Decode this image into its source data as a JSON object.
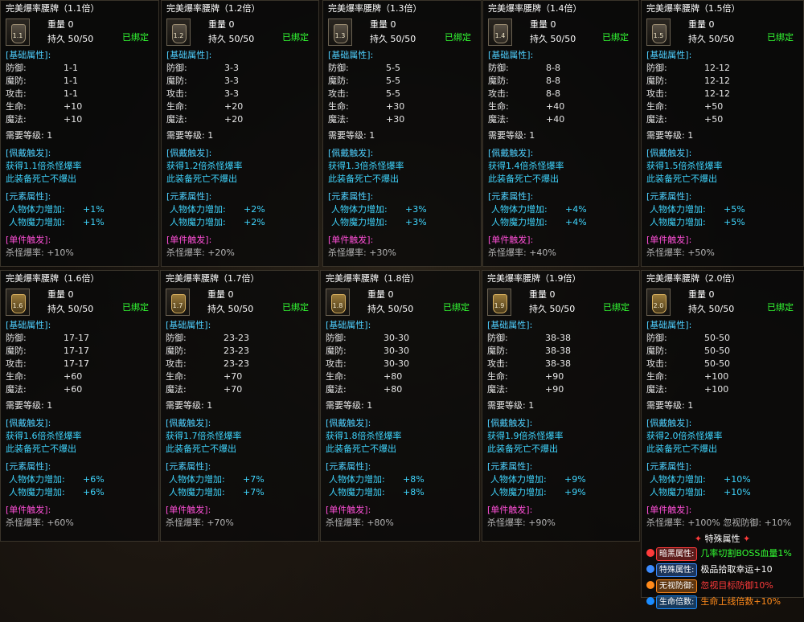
{
  "cards": [
    {
      "title": "完美爆率腰牌（1.1倍）",
      "icon_label": "1.1",
      "weight": "重量  0",
      "durability": "持久  50/50",
      "bound": "已绑定",
      "base_label": "[基础属性]:",
      "stats": [
        [
          "防御:",
          "1-1"
        ],
        [
          "魔防:",
          "1-1"
        ],
        [
          "攻击:",
          "1-1"
        ],
        [
          "生命:",
          "+10"
        ],
        [
          "魔法:",
          "+10"
        ]
      ],
      "req": "需要等级:  1",
      "trigger_label": "[佩戴触发]:",
      "trigger_1": "获得1.1倍杀怪爆率",
      "trigger_2": "此装备死亡不爆出",
      "elem_label": "[元素属性]:",
      "elem": [
        [
          "人物体力增加:",
          "+1%"
        ],
        [
          "人物魔力增加:",
          "+1%"
        ]
      ],
      "single_label": "[单件触发]:",
      "single_value": "杀怪爆率: +10%"
    },
    {
      "title": "完美爆率腰牌（1.2倍）",
      "icon_label": "1.2",
      "weight": "重量  0",
      "durability": "持久  50/50",
      "bound": "已绑定",
      "base_label": "[基础属性]:",
      "stats": [
        [
          "防御:",
          "3-3"
        ],
        [
          "魔防:",
          "3-3"
        ],
        [
          "攻击:",
          "3-3"
        ],
        [
          "生命:",
          "+20"
        ],
        [
          "魔法:",
          "+20"
        ]
      ],
      "req": "需要等级:  1",
      "trigger_label": "[佩戴触发]:",
      "trigger_1": "获得1.2倍杀怪爆率",
      "trigger_2": "此装备死亡不爆出",
      "elem_label": "[元素属性]:",
      "elem": [
        [
          "人物体力增加:",
          "+2%"
        ],
        [
          "人物魔力增加:",
          "+2%"
        ]
      ],
      "single_label": "[单件触发]:",
      "single_value": "杀怪爆率: +20%"
    },
    {
      "title": "完美爆率腰牌（1.3倍）",
      "icon_label": "1.3",
      "weight": "重量  0",
      "durability": "持久  50/50",
      "bound": "已绑定",
      "base_label": "[基础属性]:",
      "stats": [
        [
          "防御:",
          "5-5"
        ],
        [
          "魔防:",
          "5-5"
        ],
        [
          "攻击:",
          "5-5"
        ],
        [
          "生命:",
          "+30"
        ],
        [
          "魔法:",
          "+30"
        ]
      ],
      "req": "需要等级:  1",
      "trigger_label": "[佩戴触发]:",
      "trigger_1": "获得1.3倍杀怪爆率",
      "trigger_2": "此装备死亡不爆出",
      "elem_label": "[元素属性]:",
      "elem": [
        [
          "人物体力增加:",
          "+3%"
        ],
        [
          "人物魔力增加:",
          "+3%"
        ]
      ],
      "single_label": "[单件触发]:",
      "single_value": "杀怪爆率: +30%"
    },
    {
      "title": "完美爆率腰牌（1.4倍）",
      "icon_label": "1.4",
      "weight": "重量  0",
      "durability": "持久  50/50",
      "bound": "已绑定",
      "base_label": "[基础属性]:",
      "stats": [
        [
          "防御:",
          "8-8"
        ],
        [
          "魔防:",
          "8-8"
        ],
        [
          "攻击:",
          "8-8"
        ],
        [
          "生命:",
          "+40"
        ],
        [
          "魔法:",
          "+40"
        ]
      ],
      "req": "需要等级:  1",
      "trigger_label": "[佩戴触发]:",
      "trigger_1": "获得1.4倍杀怪爆率",
      "trigger_2": "此装备死亡不爆出",
      "elem_label": "[元素属性]:",
      "elem": [
        [
          "人物体力增加:",
          "+4%"
        ],
        [
          "人物魔力增加:",
          "+4%"
        ]
      ],
      "single_label": "[单件触发]:",
      "single_value": "杀怪爆率: +40%"
    },
    {
      "title": "完美爆率腰牌（1.5倍）",
      "icon_label": "1.5",
      "weight": "重量  0",
      "durability": "持久  50/50",
      "bound": "已绑定",
      "base_label": "[基础属性]:",
      "stats": [
        [
          "防御:",
          "12-12"
        ],
        [
          "魔防:",
          "12-12"
        ],
        [
          "攻击:",
          "12-12"
        ],
        [
          "生命:",
          "+50"
        ],
        [
          "魔法:",
          "+50"
        ]
      ],
      "req": "需要等级:  1",
      "trigger_label": "[佩戴触发]:",
      "trigger_1": "获得1.5倍杀怪爆率",
      "trigger_2": "此装备死亡不爆出",
      "elem_label": "[元素属性]:",
      "elem": [
        [
          "人物体力增加:",
          "+5%"
        ],
        [
          "人物魔力增加:",
          "+5%"
        ]
      ],
      "single_label": "[单件触发]:",
      "single_value": "杀怪爆率: +50%"
    },
    {
      "title": "完美爆率腰牌（1.6倍）",
      "icon_label": "1.6",
      "weight": "重量  0",
      "durability": "持久  50/50",
      "bound": "已绑定",
      "base_label": "[基础属性]:",
      "stats": [
        [
          "防御:",
          "17-17"
        ],
        [
          "魔防:",
          "17-17"
        ],
        [
          "攻击:",
          "17-17"
        ],
        [
          "生命:",
          "+60"
        ],
        [
          "魔法:",
          "+60"
        ]
      ],
      "req": "需要等级:  1",
      "trigger_label": "[佩戴触发]:",
      "trigger_1": "获得1.6倍杀怪爆率",
      "trigger_2": "此装备死亡不爆出",
      "elem_label": "[元素属性]:",
      "elem": [
        [
          "人物体力增加:",
          "+6%"
        ],
        [
          "人物魔力增加:",
          "+6%"
        ]
      ],
      "single_label": "[单件触发]:",
      "single_value": "杀怪爆率: +60%"
    },
    {
      "title": "完美爆率腰牌（1.7倍）",
      "icon_label": "1.7",
      "weight": "重量  0",
      "durability": "持久  50/50",
      "bound": "已绑定",
      "base_label": "[基础属性]:",
      "stats": [
        [
          "防御:",
          "23-23"
        ],
        [
          "魔防:",
          "23-23"
        ],
        [
          "攻击:",
          "23-23"
        ],
        [
          "生命:",
          "+70"
        ],
        [
          "魔法:",
          "+70"
        ]
      ],
      "req": "需要等级:  1",
      "trigger_label": "[佩戴触发]:",
      "trigger_1": "获得1.7倍杀怪爆率",
      "trigger_2": "此装备死亡不爆出",
      "elem_label": "[元素属性]:",
      "elem": [
        [
          "人物体力增加:",
          "+7%"
        ],
        [
          "人物魔力增加:",
          "+7%"
        ]
      ],
      "single_label": "[单件触发]:",
      "single_value": "杀怪爆率: +70%"
    },
    {
      "title": "完美爆率腰牌（1.8倍）",
      "icon_label": "1.8",
      "weight": "重量  0",
      "durability": "持久  50/50",
      "bound": "已绑定",
      "base_label": "[基础属性]:",
      "stats": [
        [
          "防御:",
          "30-30"
        ],
        [
          "魔防:",
          "30-30"
        ],
        [
          "攻击:",
          "30-30"
        ],
        [
          "生命:",
          "+80"
        ],
        [
          "魔法:",
          "+80"
        ]
      ],
      "req": "需要等级:  1",
      "trigger_label": "[佩戴触发]:",
      "trigger_1": "获得1.8倍杀怪爆率",
      "trigger_2": "此装备死亡不爆出",
      "elem_label": "[元素属性]:",
      "elem": [
        [
          "人物体力增加:",
          "+8%"
        ],
        [
          "人物魔力增加:",
          "+8%"
        ]
      ],
      "single_label": "[单件触发]:",
      "single_value": "杀怪爆率: +80%"
    },
    {
      "title": "完美爆率腰牌（1.9倍）",
      "icon_label": "1.9",
      "weight": "重量  0",
      "durability": "持久  50/50",
      "bound": "已绑定",
      "base_label": "[基础属性]:",
      "stats": [
        [
          "防御:",
          "38-38"
        ],
        [
          "魔防:",
          "38-38"
        ],
        [
          "攻击:",
          "38-38"
        ],
        [
          "生命:",
          "+90"
        ],
        [
          "魔法:",
          "+90"
        ]
      ],
      "req": "需要等级:  1",
      "trigger_label": "[佩戴触发]:",
      "trigger_1": "获得1.9倍杀怪爆率",
      "trigger_2": "此装备死亡不爆出",
      "elem_label": "[元素属性]:",
      "elem": [
        [
          "人物体力增加:",
          "+9%"
        ],
        [
          "人物魔力增加:",
          "+9%"
        ]
      ],
      "single_label": "[单件触发]:",
      "single_value": "杀怪爆率: +90%"
    },
    {
      "title": "完美爆率腰牌（2.0倍）",
      "icon_label": "2.0",
      "weight": "重量  0",
      "durability": "持久  50/50",
      "bound": "已绑定",
      "base_label": "[基础属性]:",
      "stats": [
        [
          "防御:",
          "50-50"
        ],
        [
          "魔防:",
          "50-50"
        ],
        [
          "攻击:",
          "50-50"
        ],
        [
          "生命:",
          "+100"
        ],
        [
          "魔法:",
          "+100"
        ]
      ],
      "req": "需要等级:  1",
      "trigger_label": "[佩戴触发]:",
      "trigger_1": "获得2.0倍杀怪爆率",
      "trigger_2": "此装备死亡不爆出",
      "elem_label": "[元素属性]:",
      "elem": [
        [
          "人物体力增加:",
          "+10%"
        ],
        [
          "人物魔力增加:",
          "+10%"
        ]
      ],
      "single_label": "[单件触发]:",
      "single_value": "杀怪爆率: +100%   忽视防御: +10%",
      "special_title": "特殊属性",
      "special": [
        {
          "badge": "暗黑属性:",
          "text": "几率切割BOSS血量1%",
          "badge_color": "#ff3b3b",
          "text_color": "#33ff33"
        },
        {
          "badge": "特殊属性:",
          "text": "极品拾取幸运+10",
          "badge_color": "#3b8bff",
          "text_color": "#ffffff"
        },
        {
          "badge": "无视防御:",
          "text": "忽视目标防御10%",
          "badge_color": "#ff8a1a",
          "text_color": "#ff3b3b"
        },
        {
          "badge": "生命倍数:",
          "text": "生命上线倍数+10%",
          "badge_color": "#1a8cff",
          "text_color": "#ff8a1a"
        }
      ]
    }
  ],
  "colors": {
    "section": "#4fd0ff",
    "single": "#ff4fd8",
    "bound": "#33ff33",
    "element": "#3fd6ff"
  }
}
